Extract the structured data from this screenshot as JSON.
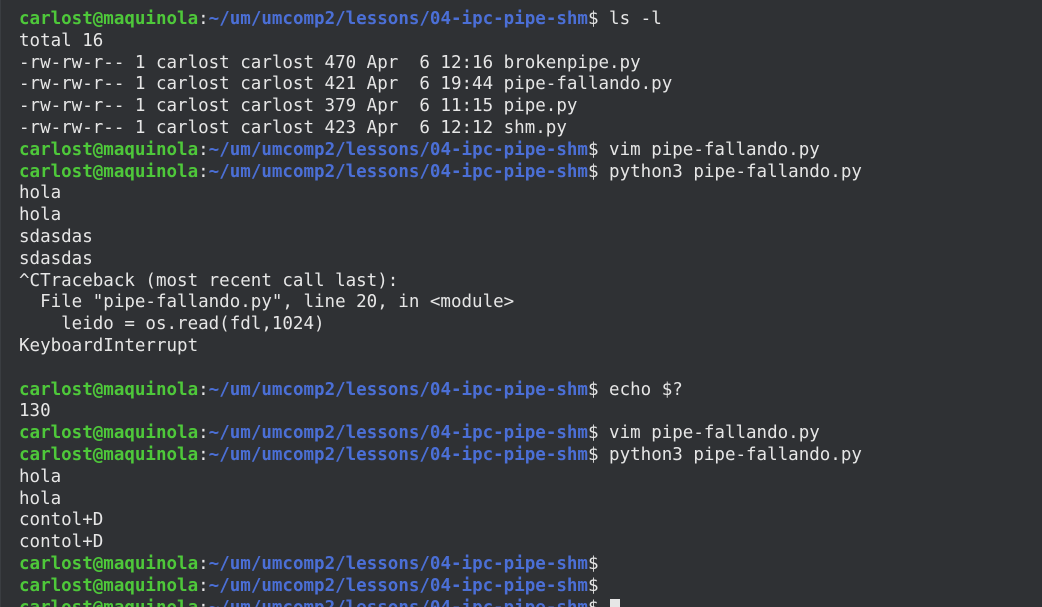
{
  "terminal": {
    "lines": [
      {
        "type": "prompt",
        "user": "carlost@maquinola",
        "path": "~/um/umcomp2/lessons/04-ipc-pipe-shm",
        "cmd": " ls -l"
      },
      {
        "type": "output",
        "text": "total 16"
      },
      {
        "type": "output",
        "text": "-rw-rw-r-- 1 carlost carlost 470 Apr  6 12:16 brokenpipe.py"
      },
      {
        "type": "output",
        "text": "-rw-rw-r-- 1 carlost carlost 421 Apr  6 19:44 pipe-fallando.py"
      },
      {
        "type": "output",
        "text": "-rw-rw-r-- 1 carlost carlost 379 Apr  6 11:15 pipe.py"
      },
      {
        "type": "output",
        "text": "-rw-rw-r-- 1 carlost carlost 423 Apr  6 12:12 shm.py"
      },
      {
        "type": "prompt",
        "user": "carlost@maquinola",
        "path": "~/um/umcomp2/lessons/04-ipc-pipe-shm",
        "cmd": " vim pipe-fallando.py"
      },
      {
        "type": "prompt",
        "user": "carlost@maquinola",
        "path": "~/um/umcomp2/lessons/04-ipc-pipe-shm",
        "cmd": " python3 pipe-fallando.py"
      },
      {
        "type": "output",
        "text": "hola"
      },
      {
        "type": "output",
        "text": "hola"
      },
      {
        "type": "output",
        "text": "sdasdas"
      },
      {
        "type": "output",
        "text": "sdasdas"
      },
      {
        "type": "output",
        "text": "^CTraceback (most recent call last):"
      },
      {
        "type": "output",
        "text": "  File \"pipe-fallando.py\", line 20, in <module>"
      },
      {
        "type": "output",
        "text": "    leido = os.read(fdl,1024)"
      },
      {
        "type": "output",
        "text": "KeyboardInterrupt"
      },
      {
        "type": "output",
        "text": ""
      },
      {
        "type": "prompt",
        "user": "carlost@maquinola",
        "path": "~/um/umcomp2/lessons/04-ipc-pipe-shm",
        "cmd": " echo $?"
      },
      {
        "type": "output",
        "text": "130"
      },
      {
        "type": "prompt",
        "user": "carlost@maquinola",
        "path": "~/um/umcomp2/lessons/04-ipc-pipe-shm",
        "cmd": " vim pipe-fallando.py"
      },
      {
        "type": "prompt",
        "user": "carlost@maquinola",
        "path": "~/um/umcomp2/lessons/04-ipc-pipe-shm",
        "cmd": " python3 pipe-fallando.py"
      },
      {
        "type": "output",
        "text": "hola"
      },
      {
        "type": "output",
        "text": "hola"
      },
      {
        "type": "output",
        "text": "contol+D"
      },
      {
        "type": "output",
        "text": "contol+D"
      },
      {
        "type": "prompt",
        "user": "carlost@maquinola",
        "path": "~/um/umcomp2/lessons/04-ipc-pipe-shm",
        "cmd": ""
      },
      {
        "type": "prompt",
        "user": "carlost@maquinola",
        "path": "~/um/umcomp2/lessons/04-ipc-pipe-shm",
        "cmd": ""
      },
      {
        "type": "prompt",
        "user": "carlost@maquinola",
        "path": "~/um/umcomp2/lessons/04-ipc-pipe-shm",
        "cmd": " ",
        "cursor": true
      }
    ]
  },
  "colors": {
    "background": "#2f3134",
    "user": "#4ec83a",
    "path": "#4b6fd6",
    "text": "#e6e6e6"
  }
}
